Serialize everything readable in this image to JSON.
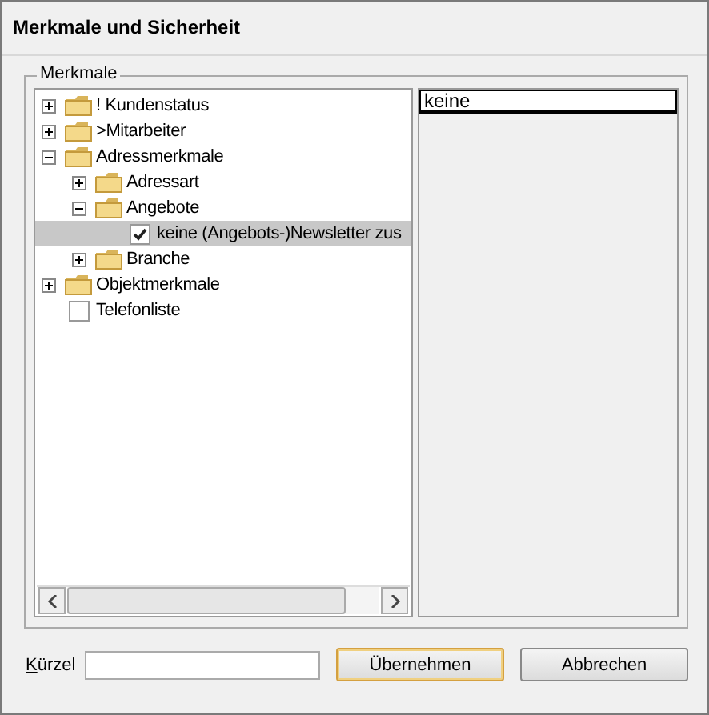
{
  "window": {
    "title": "Merkmale und Sicherheit"
  },
  "group": {
    "label": "Merkmale"
  },
  "tree": [
    {
      "kind": "folder",
      "label": "! Kundenstatus",
      "expanded": false,
      "selected": false
    },
    {
      "kind": "folder",
      "label": ">Mitarbeiter",
      "expanded": false,
      "selected": false
    },
    {
      "kind": "folder",
      "label": "Adressmerkmale",
      "expanded": true,
      "selected": false,
      "children": [
        {
          "kind": "folder",
          "label": "Adressart",
          "expanded": false,
          "selected": false
        },
        {
          "kind": "folder",
          "label": "Angebote",
          "expanded": true,
          "selected": false,
          "children": [
            {
              "kind": "checkbox",
              "label": "keine (Angebots-)Newsletter zus",
              "checked": true,
              "selected": true
            }
          ]
        },
        {
          "kind": "folder",
          "label": "Branche",
          "expanded": false,
          "selected": false
        }
      ]
    },
    {
      "kind": "folder",
      "label": "Objektmerkmale",
      "expanded": false,
      "selected": false
    },
    {
      "kind": "checkbox",
      "label": "Telefonliste",
      "checked": false,
      "selected": false
    }
  ],
  "detail": {
    "value": "keine"
  },
  "kuerzel": {
    "label": "Kürzel"
  },
  "buttons": [
    {
      "label": "Übernehmen",
      "default": true
    },
    {
      "label": "Abbrechen",
      "default": false
    }
  ]
}
